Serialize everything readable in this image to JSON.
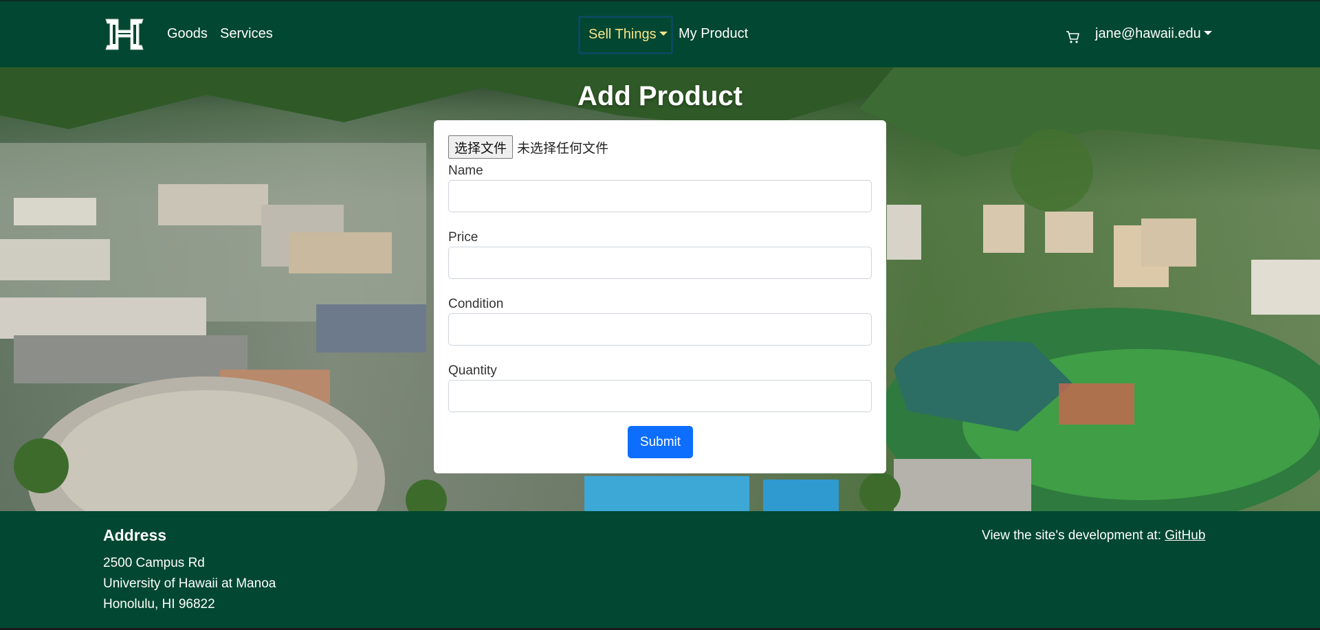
{
  "navbar": {
    "logo_icon": "uh-h-logo-icon",
    "goods_label": "Goods",
    "services_label": "Services",
    "sell_things_label": "Sell Things",
    "my_product_label": "My Product",
    "cart_icon": "shopping-cart-icon",
    "user_label": "jane@hawaii.edu"
  },
  "page": {
    "title": "Add Product"
  },
  "form": {
    "file_button_label": "选择文件",
    "file_status": "未选择任何文件",
    "fields": [
      {
        "label": "Name",
        "value": ""
      },
      {
        "label": "Price",
        "value": ""
      },
      {
        "label": "Condition",
        "value": ""
      },
      {
        "label": "Quantity",
        "value": ""
      }
    ],
    "submit_label": "Submit"
  },
  "footer": {
    "address_title": "Address",
    "address_lines": [
      "2500 Campus Rd",
      "University of Hawaii at Manoa",
      "Honolulu, HI 96822"
    ],
    "dev_text": "View the site's development at: ",
    "github_label": "GitHub"
  },
  "colors": {
    "brand_green": "#024731",
    "active_nav": "#f7e58c",
    "primary_button": "#0d6efd"
  }
}
